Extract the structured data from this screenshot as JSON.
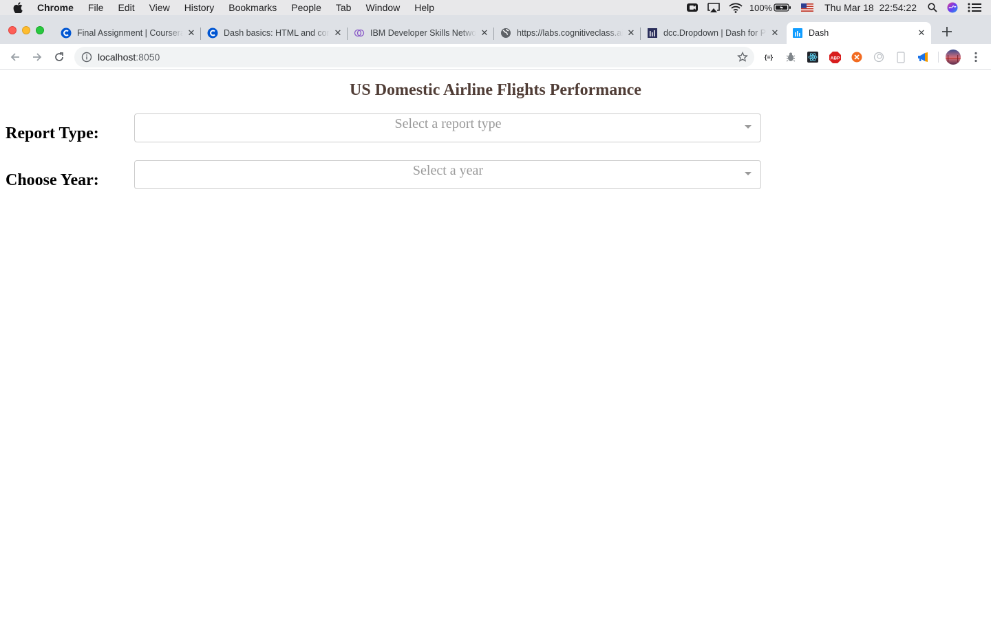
{
  "menubar": {
    "items": [
      "Chrome",
      "File",
      "Edit",
      "View",
      "History",
      "Bookmarks",
      "People",
      "Tab",
      "Window",
      "Help"
    ],
    "battery": "100%",
    "clock": "Thu Mar 18  22:54:22"
  },
  "tabs": [
    {
      "title": "Final Assignment | Coursera",
      "icon": "coursera-icon"
    },
    {
      "title": "Dash basics: HTML and core components",
      "icon": "coursera-icon"
    },
    {
      "title": "IBM Developer Skills Network",
      "icon": "ibm-skills-icon"
    },
    {
      "title": "https://labs.cognitiveclass.ai",
      "icon": "globe-icon"
    },
    {
      "title": "dcc.Dropdown | Dash for Python",
      "icon": "dash-docs-icon"
    },
    {
      "title": "Dash",
      "icon": "dash-icon",
      "active": true
    }
  ],
  "toolbar": {
    "url_host": "localhost",
    "url_port": ":8050"
  },
  "page": {
    "title": "US Domestic Airline Flights Performance",
    "title_color": "#503D36",
    "report_label": "Report Type:",
    "report_placeholder": "Select a report type",
    "year_label": "Choose Year:",
    "year_placeholder": "Select a year"
  }
}
